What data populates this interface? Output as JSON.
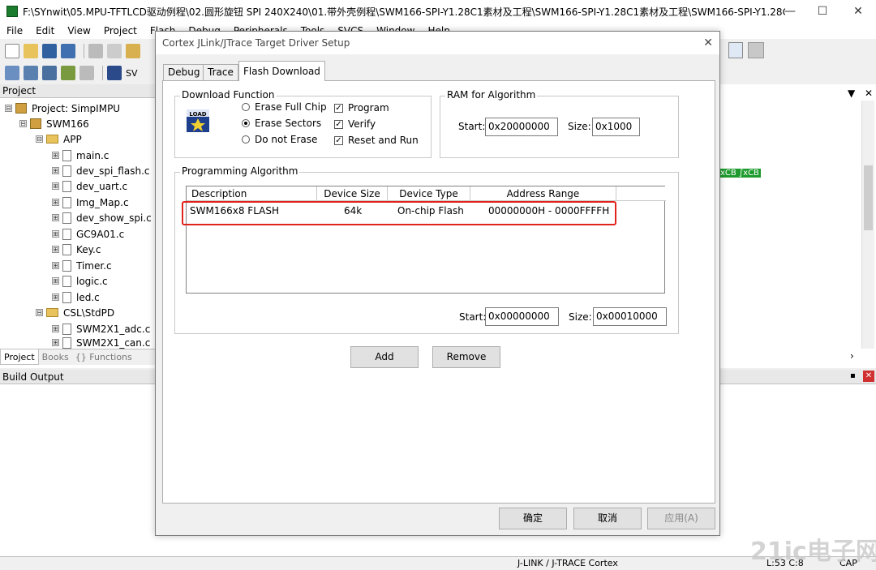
{
  "app": {
    "title": "F:\\SYnwit\\05.MPU-TFTLCD驱动例程\\02.圆形旋钮 SPI 240X240\\01.带外壳例程\\SWM166-SPI-Y1.28C1素材及工程\\SWM166-SPI-Y1.28C1素材及工程\\SWM166-SPI-Y1.28C...",
    "minimize": "—",
    "maximize": "☐",
    "close": "✕"
  },
  "menu": [
    "File",
    "Edit",
    "View",
    "Project",
    "Flash",
    "Debug",
    "Peripherals",
    "Tools",
    "SVCS",
    "Window",
    "Help"
  ],
  "toolbar2_label": "SV",
  "project_pane": {
    "header": "Project",
    "items": [
      {
        "label": "Project: SimpIMPU",
        "type": "project",
        "level": 0,
        "expander": "⊟"
      },
      {
        "label": "SWM166",
        "type": "target",
        "level": 1,
        "expander": "⊟"
      },
      {
        "label": "APP",
        "type": "folder",
        "level": 2,
        "expander": "⊟"
      },
      {
        "label": "main.c",
        "type": "file",
        "level": 3,
        "expander": "⊞"
      },
      {
        "label": "dev_spi_flash.c",
        "type": "file",
        "level": 3,
        "expander": "⊞"
      },
      {
        "label": "dev_uart.c",
        "type": "file",
        "level": 3,
        "expander": "⊞"
      },
      {
        "label": "Img_Map.c",
        "type": "file",
        "level": 3,
        "expander": "⊞"
      },
      {
        "label": "dev_show_spi.c",
        "type": "file",
        "level": 3,
        "expander": "⊞"
      },
      {
        "label": "GC9A01.c",
        "type": "file",
        "level": 3,
        "expander": "⊞"
      },
      {
        "label": "Key.c",
        "type": "file",
        "level": 3,
        "expander": "⊞"
      },
      {
        "label": "Timer.c",
        "type": "file",
        "level": 3,
        "expander": "⊞"
      },
      {
        "label": "logic.c",
        "type": "file",
        "level": 3,
        "expander": "⊞"
      },
      {
        "label": "led.c",
        "type": "file",
        "level": 3,
        "expander": "⊞"
      },
      {
        "label": "CSL\\StdPD",
        "type": "folder",
        "level": 2,
        "expander": "⊟"
      },
      {
        "label": "SWM2X1_adc.c",
        "type": "file",
        "level": 3,
        "expander": "⊞"
      },
      {
        "label": "SWM2X1_can.c",
        "type": "file",
        "level": 3,
        "expander": "⊞"
      }
    ],
    "tabs": [
      "Project",
      "Books",
      "{} Functions"
    ]
  },
  "editor_snippet": "xCB ∫xCB",
  "build_output": {
    "header": "Build Output"
  },
  "status": {
    "debugger": "J-LINK / J-TRACE Cortex",
    "position": "L:53 C:8",
    "caps": "CAP"
  },
  "watermark": "21ic电子网",
  "dialog": {
    "title": "Cortex JLink/JTrace Target Driver Setup",
    "close": "✕",
    "tabs": [
      "Debug",
      "Trace",
      "Flash Download"
    ],
    "active_tab": "Flash Download",
    "download_function": {
      "label": "Download Function",
      "icon_text": "LOAD",
      "radios": [
        {
          "label": "Erase Full Chip",
          "checked": false
        },
        {
          "label": "Erase Sectors",
          "checked": true
        },
        {
          "label": "Do not Erase",
          "checked": false
        }
      ],
      "checks": [
        {
          "label": "Program",
          "checked": true
        },
        {
          "label": "Verify",
          "checked": true
        },
        {
          "label": "Reset and Run",
          "checked": true
        }
      ]
    },
    "ram": {
      "label": "RAM for Algorithm",
      "start_label": "Start:",
      "start_value": "0x20000000",
      "size_label": "Size:",
      "size_value": "0x1000"
    },
    "algorithm": {
      "label": "Programming Algorithm",
      "columns": [
        "Description",
        "Device Size",
        "Device Type",
        "Address Range"
      ],
      "rows": [
        {
          "description": "SWM166x8 FLASH",
          "size": "64k",
          "type": "On-chip Flash",
          "range": "00000000H - 0000FFFFH"
        }
      ],
      "start_label": "Start:",
      "start_value": "0x00000000",
      "size_label": "Size:",
      "size_value": "0x00010000"
    },
    "add": "Add",
    "remove": "Remove",
    "ok": "确定",
    "cancel": "取消",
    "apply": "应用(A)",
    "highlight_color": "#e0241b"
  }
}
